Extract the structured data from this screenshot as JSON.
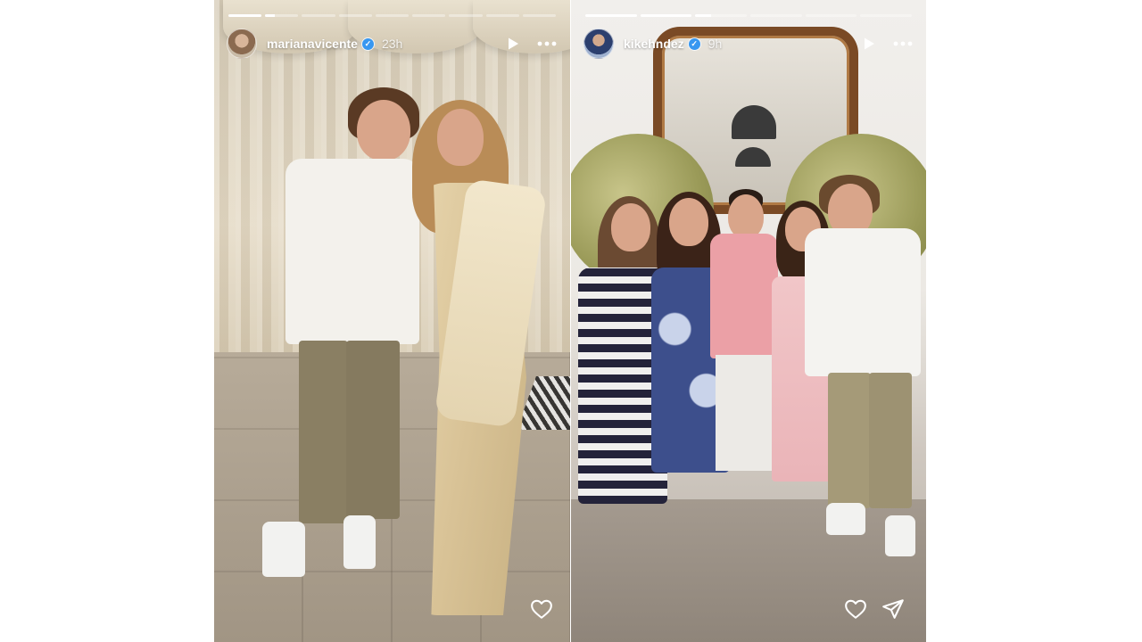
{
  "stories": [
    {
      "username": "marianavicente",
      "verified": true,
      "time_ago": "23h",
      "progress_segments": 9,
      "active_segment": 2,
      "icons": [
        "play-icon",
        "more-options-icon",
        "heart-icon"
      ]
    },
    {
      "username": "kikehndez",
      "verified": true,
      "time_ago": "9h",
      "progress_segments": 6,
      "active_segment": 3,
      "icons": [
        "play-icon",
        "more-options-icon",
        "heart-icon",
        "send-icon"
      ]
    }
  ],
  "colors": {
    "verified_badge": "#3897f0",
    "progress_active": "#ffffff",
    "progress_inactive": "rgba(255,255,255,0.38)"
  }
}
